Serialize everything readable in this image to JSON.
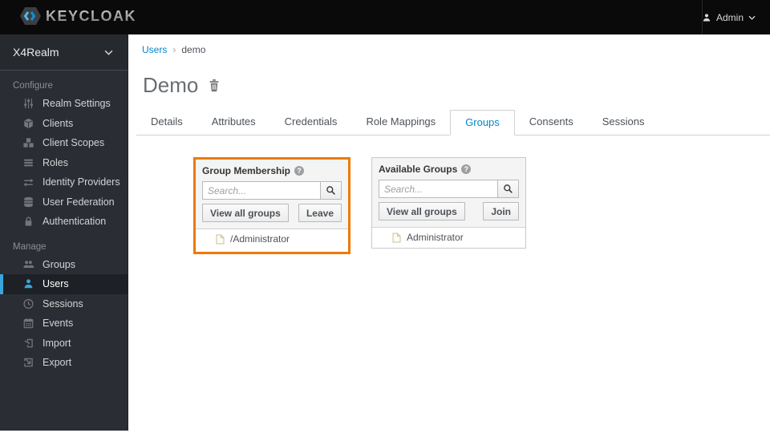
{
  "topbar": {
    "brand": "KEYCLOAK",
    "user_menu": {
      "label": "Admin"
    }
  },
  "sidebar": {
    "realm_selector": {
      "label": "X4Realm"
    },
    "sections": [
      {
        "label": "Configure",
        "items": [
          {
            "label": "Realm Settings",
            "icon": "sliders-icon"
          },
          {
            "label": "Clients",
            "icon": "cube-icon"
          },
          {
            "label": "Client Scopes",
            "icon": "cubes-icon"
          },
          {
            "label": "Roles",
            "icon": "list-icon"
          },
          {
            "label": "Identity Providers",
            "icon": "exchange-icon"
          },
          {
            "label": "User Federation",
            "icon": "database-icon"
          },
          {
            "label": "Authentication",
            "icon": "lock-icon"
          }
        ]
      },
      {
        "label": "Manage",
        "items": [
          {
            "label": "Groups",
            "icon": "group-icon"
          },
          {
            "label": "Users",
            "icon": "user-icon",
            "active": true
          },
          {
            "label": "Sessions",
            "icon": "clock-icon"
          },
          {
            "label": "Events",
            "icon": "calendar-icon"
          },
          {
            "label": "Import",
            "icon": "import-icon"
          },
          {
            "label": "Export",
            "icon": "export-icon"
          }
        ]
      }
    ]
  },
  "breadcrumb": {
    "items": [
      {
        "label": "Users"
      },
      {
        "label": "demo"
      }
    ]
  },
  "page": {
    "title": "Demo"
  },
  "tabs": [
    {
      "label": "Details"
    },
    {
      "label": "Attributes"
    },
    {
      "label": "Credentials"
    },
    {
      "label": "Role Mappings"
    },
    {
      "label": "Groups",
      "active": true
    },
    {
      "label": "Consents"
    },
    {
      "label": "Sessions"
    }
  ],
  "panels": [
    {
      "title": "Group Membership",
      "search_placeholder": "Search...",
      "view_all_label": "View all groups",
      "action_label": "Leave",
      "rows": [
        {
          "label": "/Administrator",
          "icon": "file-icon"
        }
      ],
      "highlighted": true
    },
    {
      "title": "Available Groups",
      "search_placeholder": "Search...",
      "view_all_label": "View all groups",
      "action_label": "Join",
      "rows": [
        {
          "label": "Administrator",
          "icon": "file-icon"
        }
      ],
      "highlighted": false
    }
  ],
  "colors": {
    "link_blue": "#0088ce",
    "active_tab_blue": "#0088ce",
    "highlight_orange": "#ec7a08",
    "nav_active_blue": "#39a5dc",
    "topbar_bg": "#0a0a0a",
    "sidebar_bg": "#2a2e34"
  }
}
